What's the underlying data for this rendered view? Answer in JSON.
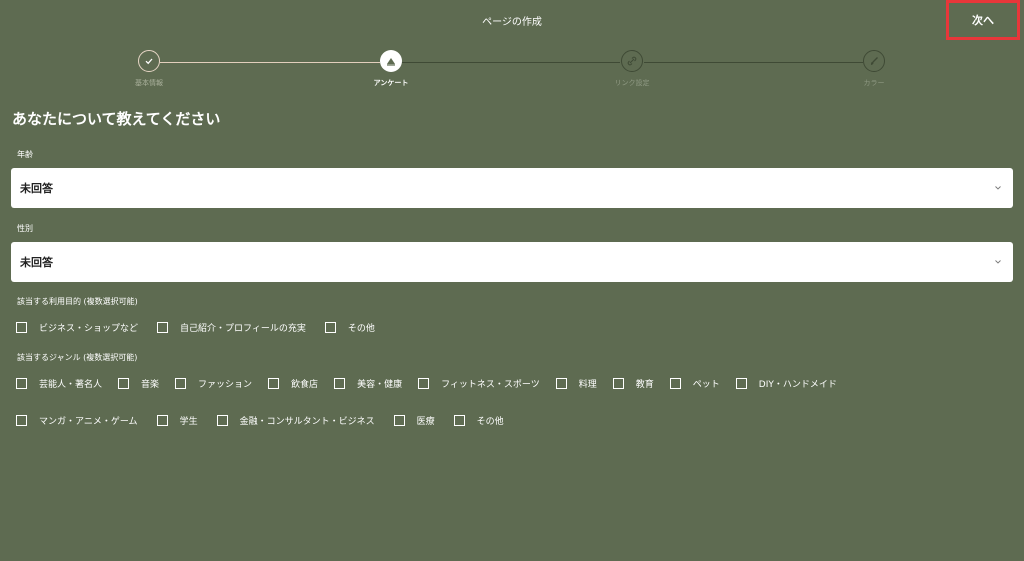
{
  "header": {
    "title": "ページの作成",
    "next_label": "次へ"
  },
  "stepper": {
    "steps": [
      {
        "label": "基本情報",
        "state": "done"
      },
      {
        "label": "アンケート",
        "state": "active"
      },
      {
        "label": "リンク設定",
        "state": "todo"
      },
      {
        "label": "カラー",
        "state": "todo"
      }
    ]
  },
  "form": {
    "heading": "あなたについて教えてください",
    "age": {
      "label": "年齢",
      "value": "未回答"
    },
    "gender": {
      "label": "性別",
      "value": "未回答"
    },
    "purpose": {
      "label": "該当する利用目的 (複数選択可能)",
      "options": [
        "ビジネス・ショップなど",
        "自己紹介・プロフィールの充実",
        "その他"
      ]
    },
    "genre": {
      "label": "該当するジャンル (複数選択可能)",
      "options_row1": [
        "芸能人・著名人",
        "音楽",
        "ファッション",
        "飲食店",
        "美容・健康",
        "フィットネス・スポーツ",
        "料理",
        "教育",
        "ペット",
        "DIY・ハンドメイド"
      ],
      "options_row2": [
        "マンガ・アニメ・ゲーム",
        "学生",
        "金融・コンサルタント・ビジネス",
        "医療",
        "その他"
      ]
    }
  },
  "colors": {
    "background": "#5e6b51",
    "highlight": "#e8363a"
  }
}
